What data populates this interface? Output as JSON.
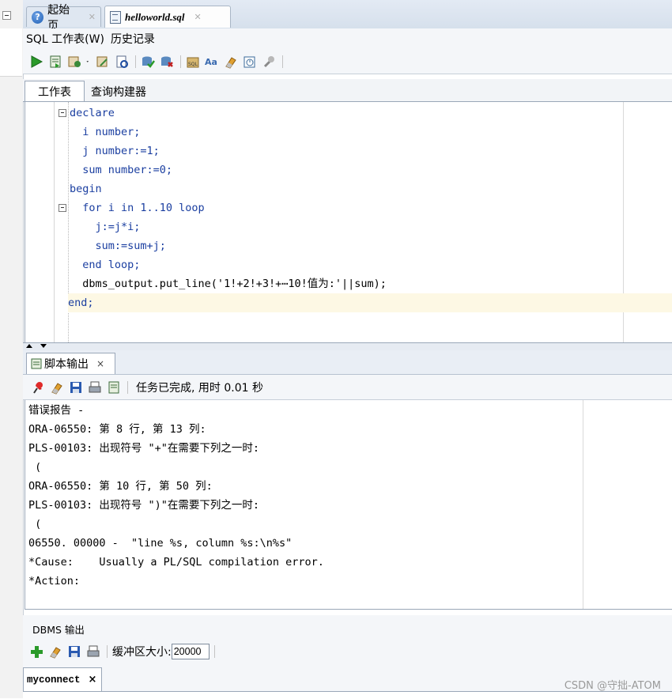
{
  "tabs": {
    "start_label": "起始页",
    "sql_label": "helloworld.sql"
  },
  "sub_tabs": {
    "worksheet": "SQL 工作表(W)",
    "history": "历史记录"
  },
  "editor_tabs": {
    "worksheet": "工作表",
    "query_builder": "查询构建器"
  },
  "code": [
    "declare",
    "  i number;",
    "  j number:=1;",
    "  sum number:=0;",
    "begin",
    "  for i in 1..10 loop",
    "    j:=j*i;",
    "    sum:=sum+j;",
    "  end loop;",
    "  dbms_output.put_line('1!+2!+3!+⋯10!值为:'||sum);",
    "end;"
  ],
  "script_output": {
    "tab_label": "脚本输出",
    "close": "×",
    "status": "任务已完成, 用时 0.01 秒",
    "lines": [
      "错误报告 -",
      "ORA-06550: 第 8 行, 第 13 列:",
      "PLS-00103: 出现符号 \"+\"在需要下列之一时:",
      " (",
      "ORA-06550: 第 10 行, 第 50 列:",
      "PLS-00103: 出现符号 \")\"在需要下列之一时:",
      " (",
      "06550. 00000 -  \"line %s, column %s:\\n%s\"",
      "*Cause:    Usually a PL/SQL compilation error.",
      "*Action:"
    ]
  },
  "dbms": {
    "title": "DBMS 输出",
    "buffer_label": "缓冲区大小:",
    "buffer_value": "20000",
    "connection_tab": "myconnect",
    "connection_close": "×"
  },
  "watermark": "CSDN @守拙-ATOM",
  "icons": [
    "help-icon",
    "sql-file-icon",
    "run-icon",
    "run-script-icon",
    "commit-icon",
    "rollback-icon",
    "format-icon",
    "eraser-icon",
    "pin-icon",
    "save-icon",
    "print-icon",
    "add-icon"
  ],
  "colors": {
    "keyword": "#1a3ea0",
    "highlight_line": "#fdf8e4",
    "chrome_bg": "#f4f6f9"
  }
}
